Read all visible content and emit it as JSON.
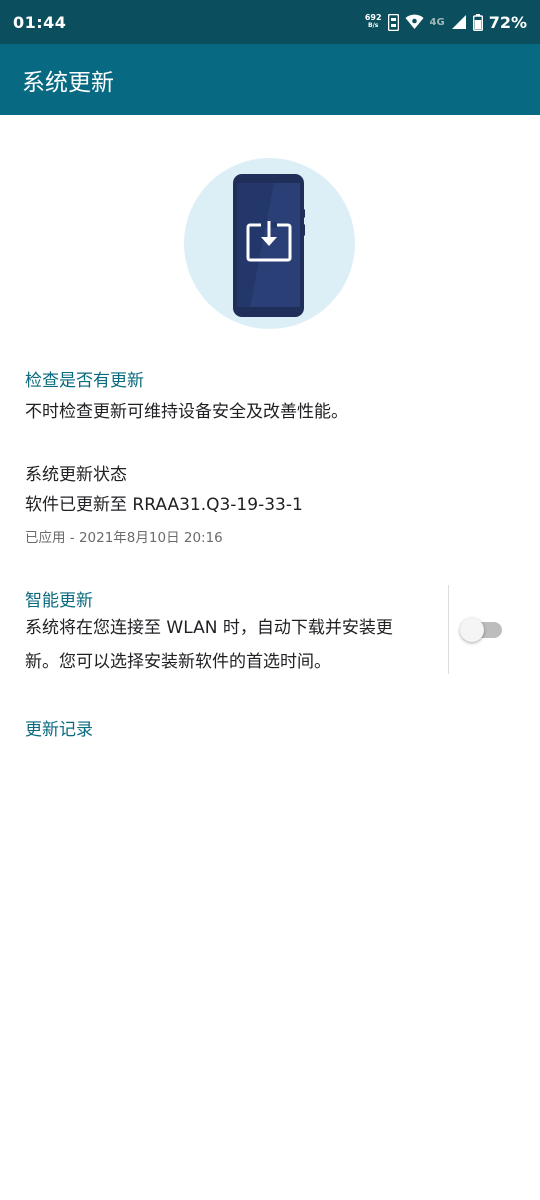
{
  "status_bar": {
    "time": "01:44",
    "net_speed_value": "692",
    "net_speed_unit": "B/s",
    "network_type": "4G",
    "battery": "72%"
  },
  "app_bar": {
    "title": "系统更新"
  },
  "check_update": {
    "title": "检查是否有更新",
    "description": "不时检查更新可维持设备安全及改善性能。"
  },
  "update_status": {
    "title": "系统更新状态",
    "version_text": "软件已更新至 RRAA31.Q3-19-33-1",
    "applied_text": "已应用 - 2021年8月10日 20:16"
  },
  "smart_update": {
    "title": "智能更新",
    "description_line1": "系统将在您连接至 WLAN 时，自动下载并安装更",
    "description_line2": "新。您可以选择安装新软件的首选时间。",
    "enabled": false
  },
  "history": {
    "label": "更新记录"
  },
  "colors": {
    "status_bar": "#0b4f5e",
    "app_bar": "#076a82",
    "accent_text": "#0a6a7f",
    "hero_circle": "#ddeff6",
    "phone_body": "#1f2f5a"
  },
  "icons": [
    "signal-icon",
    "wifi-icon",
    "sim-icon",
    "battery-icon",
    "phone-download-illustration"
  ]
}
